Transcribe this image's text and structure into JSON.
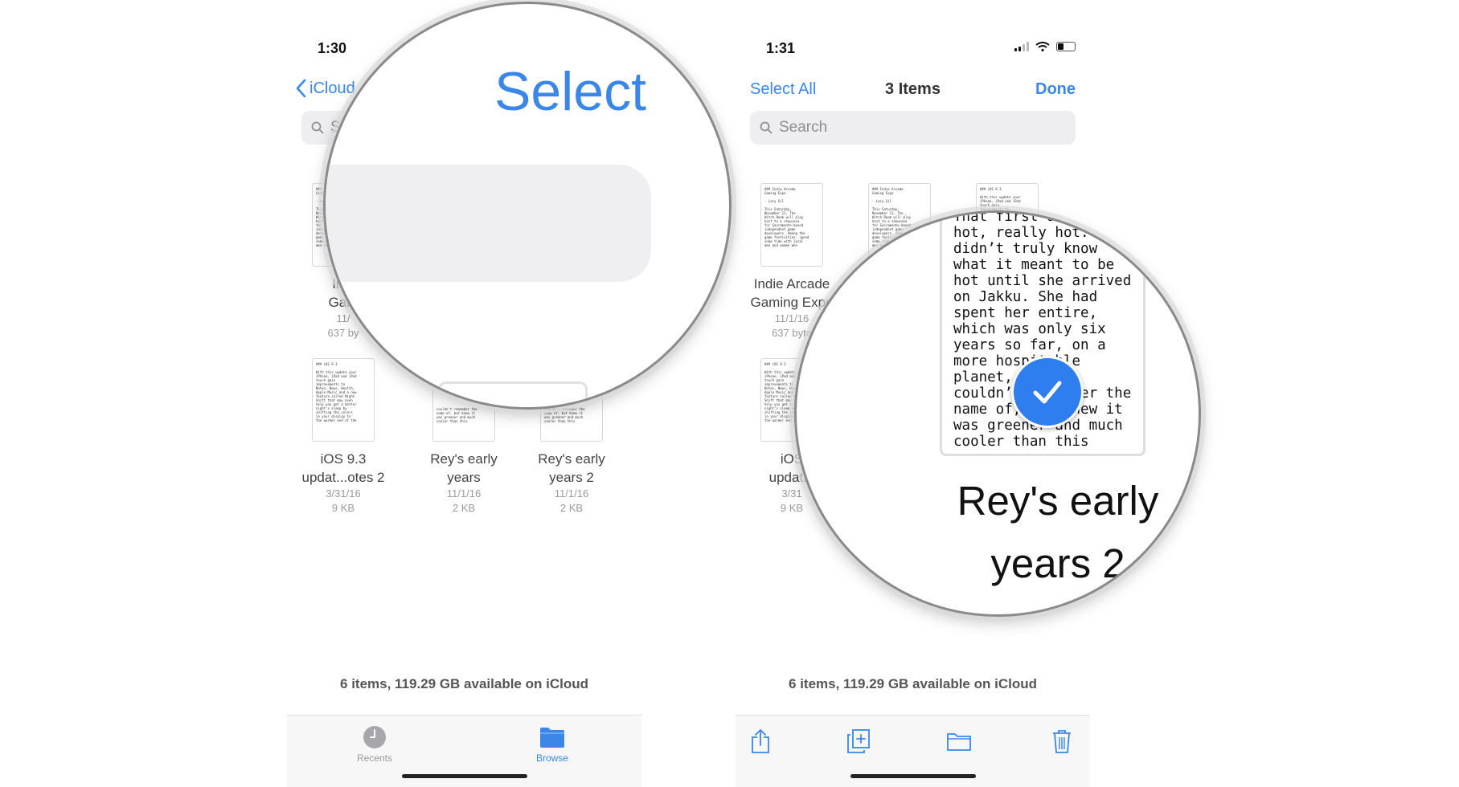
{
  "phone1": {
    "status_time": "1:30",
    "back_label": "iCloud",
    "search_placeholder": "S",
    "files": [
      {
        "name_line1": "Indi",
        "name_line2": "Gam",
        "date": "11/",
        "size": "637 by"
      },
      {
        "name_line1": "iOS 9.3",
        "name_line2": "updat...otes 2",
        "date": "3/31/16",
        "size": "9 KB"
      },
      {
        "name_line1": "Rey's early",
        "name_line2": "years",
        "date": "11/1/16",
        "size": "2 KB"
      },
      {
        "name_line1": "Rey's early",
        "name_line2": "years 2",
        "date": "11/1/16",
        "size": "2 KB"
      }
    ],
    "footer_info": "6 items, 119.29 GB available on iCloud",
    "tabs": {
      "recents": "Recents",
      "browse": "Browse"
    },
    "magnifier": {
      "select_label": "Select"
    }
  },
  "phone2": {
    "status_time": "1:31",
    "select_all": "Select All",
    "title": "3 Items",
    "done": "Done",
    "search_placeholder": "Search",
    "files": [
      {
        "name_line1": "Indie Arcade",
        "name_line2": "Gaming Expo",
        "date": "11/1/16",
        "size": "637 byte"
      },
      {
        "name_line1": "iOS",
        "name_line2": "updat...",
        "date": "3/31",
        "size": "9 KB"
      }
    ],
    "footer_info": "6 items, 119.29 GB available on iCloud",
    "magnifier": {
      "card_text": "That first day\nhot, really hot.\ndidn’t truly know\nwhat it meant to be\nhot until she arrived\non Jakku. She had\nspent her entire,\nwhich was only six\nyears so far, on a\nmore hospitable\nplanet, one she\ncouldn’t remember the\nname of, but knew it\nwas greener and much\ncooler than this",
      "name_line1": "Rey's early",
      "name_line2": "years 2"
    }
  },
  "thumbs": {
    "indie": "### Indie Arcade\nGaming Expo\n\n- Lary Gil\n\nThis Saturday,\nNovember 12, The\nWitch Room will play\nhost to a showcase\nfor Sacramento-based\nindependent game\ndevelopers. Among the\ngame festivities, spend\nsome time with local\nmen and women who",
    "ios": "### iOS 9.3\n\nWith this update your\niPhone, iPad and iPod\ntouch gain\nimprovements to\nNotes, News, Health,\nApple Music and a new\nfeature called Night\nShift that may even\nhelp you get a better\nnight's sleep by\nshifting the colors\nin your display to\nthe warmer end of the",
    "rey": "couldn't remember the\nname of, but knew it\nwas greener and much\ncooler than this"
  },
  "colors": {
    "accent": "#3a87e8",
    "check": "#2f7ef0"
  }
}
